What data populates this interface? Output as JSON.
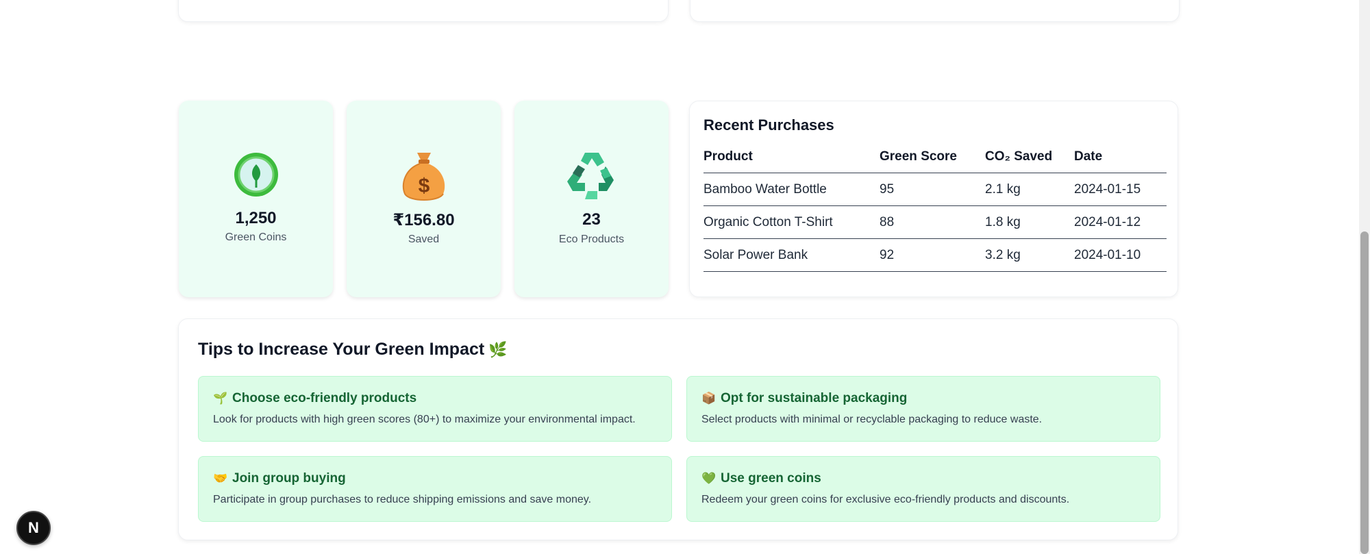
{
  "stats": [
    {
      "icon": "leaf-coin-icon",
      "value": "1,250",
      "label": "Green Coins"
    },
    {
      "icon": "money-bag-icon",
      "value": "₹156.80",
      "label": "Saved"
    },
    {
      "icon": "recycle-icon",
      "value": "23",
      "label": "Eco Products"
    }
  ],
  "purchases": {
    "title": "Recent Purchases",
    "headers": [
      "Product",
      "Green Score",
      "CO₂ Saved",
      "Date"
    ],
    "rows": [
      [
        "Bamboo Water Bottle",
        "95",
        "2.1 kg",
        "2024-01-15"
      ],
      [
        "Organic Cotton T-Shirt",
        "88",
        "1.8 kg",
        "2024-01-12"
      ],
      [
        "Solar Power Bank",
        "92",
        "3.2 kg",
        "2024-01-10"
      ]
    ]
  },
  "tips": {
    "title": "Tips to Increase Your Green Impact",
    "title_emoji": "🌿",
    "items": [
      {
        "icon": "seedling-icon",
        "glyph": "🌱",
        "title": "Choose eco-friendly products",
        "desc": "Look for products with high green scores (80+) to maximize your environmental impact."
      },
      {
        "icon": "package-icon",
        "glyph": "📦",
        "title": "Opt for sustainable packaging",
        "desc": "Select products with minimal or recyclable packaging to reduce waste."
      },
      {
        "icon": "handshake-icon",
        "glyph": "🤝",
        "title": "Join group buying",
        "desc": "Participate in group purchases to reduce shipping emissions and save money."
      },
      {
        "icon": "green-heart-icon",
        "glyph": "💚",
        "title": "Use green coins",
        "desc": "Redeem your green coins for exclusive eco-friendly products and discounts."
      }
    ]
  },
  "badge": {
    "letter": "N"
  },
  "colors": {
    "accent": "#166534",
    "stat_bg": "#ecfdf5",
    "tip_bg": "#dcfce7"
  }
}
